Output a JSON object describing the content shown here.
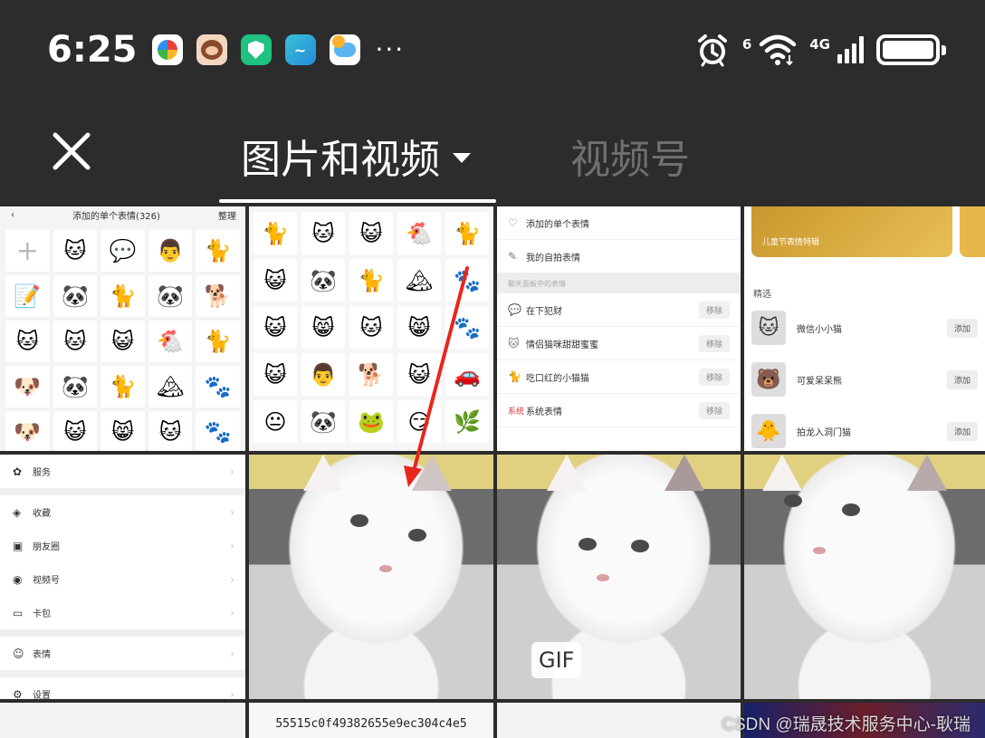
{
  "status_bar": {
    "time": "6:25",
    "app_icons": [
      "color-wheel-icon",
      "monkey-app-icon",
      "shield-app-icon",
      "fish-app-icon",
      "weather-app-icon"
    ],
    "more": "···",
    "network_label": "4G",
    "wifi_label": "6",
    "battery_level": 1.0
  },
  "header": {
    "tabs": [
      {
        "label": "图片和视频",
        "active": true
      },
      {
        "label": "视频号",
        "active": false
      }
    ]
  },
  "grid": {
    "cell1": {
      "back": "‹",
      "title": "添加的单个表情(326)",
      "action": "整理",
      "stickers": [
        "+",
        "🐱",
        "💬",
        "👨",
        "🐈",
        "📝",
        "🐼",
        "🐈",
        "🐼",
        "🐕",
        "🐱",
        "🐱",
        "😺",
        "🐔",
        "🐈",
        "🐶",
        "🐼",
        "🐈",
        "🏔",
        "🐾",
        "🐶",
        "😺",
        "😸",
        "🐱",
        "🐾"
      ]
    },
    "cell2": {
      "stickers": [
        "🐈",
        "🐱",
        "😺",
        "🐔",
        "🐈",
        "😺",
        "🐼",
        "🐈",
        "🏔",
        "🐾",
        "😺",
        "😸",
        "🐱",
        "😸",
        "🐾",
        "😺",
        "👨",
        "🐕",
        "😺",
        "🚗",
        "😐",
        "🐼",
        "🐸",
        "😏",
        "🌿"
      ]
    },
    "cell3": {
      "rows": [
        {
          "icon": "♡",
          "label": "添加的单个表情"
        },
        {
          "icon": "✎",
          "label": "我的自拍表情"
        }
      ],
      "section": "聊天面板中的表情",
      "items": [
        {
          "icon": "💬",
          "label": "在下犯财",
          "action": "移除"
        },
        {
          "icon": "🐱",
          "label": "情侣猫咪甜甜蜜蜜",
          "action": "移除"
        },
        {
          "icon": "🐈",
          "label": "吃口红的小猫猫",
          "action": "移除"
        },
        {
          "icon": "系统",
          "label": "系统表情",
          "action": "移除"
        }
      ]
    },
    "cell4": {
      "banner_title": "儿童节表情特辑",
      "section": "精选",
      "items": [
        {
          "icon": "🐱",
          "label": "微信小小猫",
          "action": "添加"
        },
        {
          "icon": "🐻",
          "label": "可爱呆呆熊",
          "action": "添加"
        },
        {
          "icon": "🐥",
          "label": "拍龙入洞门猫",
          "action": "添加"
        }
      ]
    },
    "cell5": {
      "items": [
        {
          "icon": "✿",
          "label": "服务"
        },
        {
          "icon": "◈",
          "label": "收藏"
        },
        {
          "icon": "▣",
          "label": "朋友圈"
        },
        {
          "icon": "◉",
          "label": "视频号"
        },
        {
          "icon": "▭",
          "label": "卡包"
        },
        {
          "icon": "☺",
          "label": "表情"
        },
        {
          "icon": "⚙",
          "label": "设置"
        }
      ],
      "arrow": "›"
    },
    "cell7": {
      "badge": "GIF"
    },
    "cell10": {
      "text": "55515c0f49382655e9ec304c4e5"
    }
  },
  "watermark": "CSDN @瑞晟技术服务中心-耿瑞",
  "colors": {
    "background": "#2c2c2c",
    "inactive_tab": "#6f6f6f",
    "arrow": "#e8261c"
  }
}
